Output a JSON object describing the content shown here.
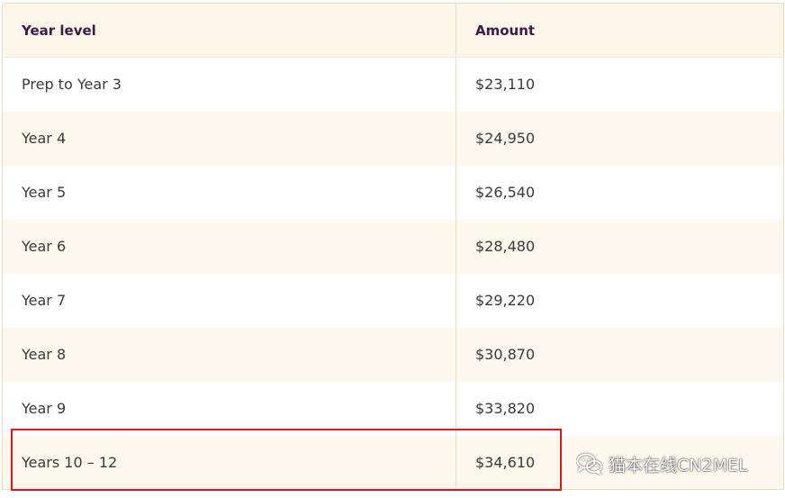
{
  "table": {
    "headers": {
      "year_level": "Year level",
      "amount": "Amount"
    },
    "rows": [
      {
        "year": "Prep to Year 3",
        "amount": "$23,110"
      },
      {
        "year": "Year 4",
        "amount": "$24,950"
      },
      {
        "year": "Year 5",
        "amount": "$26,540"
      },
      {
        "year": "Year 6",
        "amount": "$28,480"
      },
      {
        "year": "Year 7",
        "amount": "$29,220"
      },
      {
        "year": "Year 8",
        "amount": "$30,870"
      },
      {
        "year": "Year 9",
        "amount": "$33,820"
      },
      {
        "year": "Years 10 – 12",
        "amount": "$34,610"
      }
    ]
  },
  "highlight": {
    "row_index": 7,
    "color": "#e0161c"
  },
  "watermark": {
    "icon": "wechat-icon",
    "text": "猫本在线CN2MEL"
  },
  "colors": {
    "header_bg": "#fbf6e9",
    "header_text": "#3d1a49",
    "row_alt_bg": "#fcf8ee",
    "border": "#eadfc3"
  }
}
